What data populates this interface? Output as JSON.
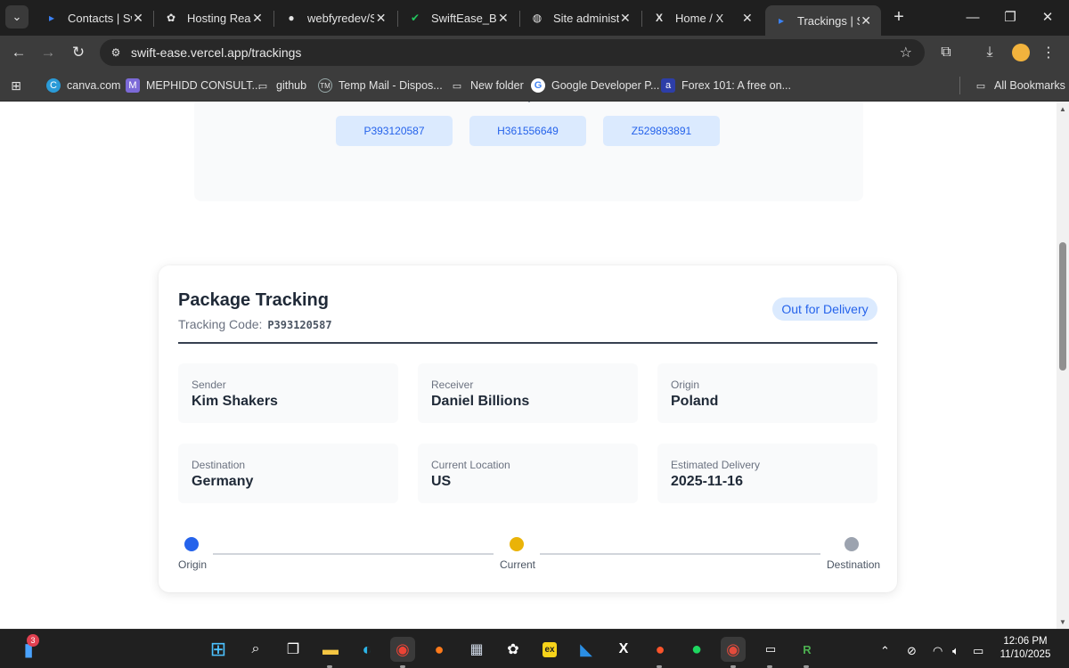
{
  "browser": {
    "tabs": [
      {
        "label": "Contacts | Swi",
        "icon": "swiftease-favicon"
      },
      {
        "label": "Hosting React",
        "icon": "openai-icon"
      },
      {
        "label": "webfyredev/Sv",
        "icon": "github-icon"
      },
      {
        "label": "SwiftEase_Bacl",
        "icon": "django-icon"
      },
      {
        "label": "Site administr",
        "icon": "globe-icon"
      },
      {
        "label": "Home / X",
        "icon": "x-icon"
      },
      {
        "label": "Trackings | Sw",
        "icon": "swiftease-favicon",
        "active": true
      }
    ],
    "url": "swift-ease.vercel.app/trackings",
    "bookmarks": [
      {
        "label": "canva.com",
        "icon": "canva-icon"
      },
      {
        "label": "MEPHIDD CONSULT...",
        "icon": "mephidd-icon"
      },
      {
        "label": "github",
        "icon": "folder-icon"
      },
      {
        "label": "Temp Mail - Dispos...",
        "icon": "tempmail-icon"
      },
      {
        "label": "New folder",
        "icon": "folder-icon"
      },
      {
        "label": "Google Developer P...",
        "icon": "google-icon"
      },
      {
        "label": "Forex 101: A free on...",
        "icon": "forex-icon"
      }
    ],
    "all_bookmarks_label": "All Bookmarks"
  },
  "codes": {
    "items": [
      "P393120587",
      "H361556649",
      "Z529893891"
    ]
  },
  "tracking": {
    "title": "Package Tracking",
    "code_label": "Tracking Code:",
    "code": "P393120587",
    "status": "Out for Delivery",
    "fields": [
      {
        "label": "Sender",
        "value": "Kim Shakers"
      },
      {
        "label": "Receiver",
        "value": "Daniel Billions"
      },
      {
        "label": "Origin",
        "value": "Poland"
      },
      {
        "label": "Destination",
        "value": "Germany"
      },
      {
        "label": "Current Location",
        "value": "US"
      },
      {
        "label": "Estimated Delivery",
        "value": "2025-11-16"
      }
    ],
    "progress": {
      "steps": [
        "Origin",
        "Current",
        "Destination"
      ],
      "colors": {
        "origin": "#2563eb",
        "current": "#eab308",
        "destination": "#9ca3af"
      }
    }
  },
  "taskbar": {
    "notification_count": "3",
    "time": "12:06 PM",
    "date": "11/10/2025"
  },
  "colors": {
    "accent": "#2563eb",
    "badge_bg": "#dbeafe"
  }
}
